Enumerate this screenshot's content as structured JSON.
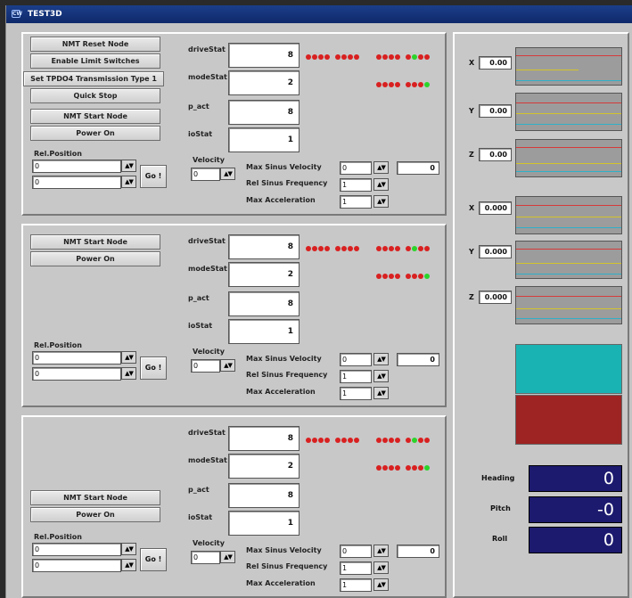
{
  "window": {
    "title": "TEST3D",
    "icon": "CW"
  },
  "colors": {
    "led_red": "#d92020",
    "led_green": "#2bd42b",
    "cyan": "#1ab3b3",
    "darkred": "#9e2323",
    "navy": "#1c1a6e"
  },
  "labels": {
    "driveStat": "driveStat",
    "modeStat": "modeStat",
    "p_act": "p_act",
    "ioStat": "ioStat",
    "velocity": "Velocity",
    "max_sinus_velocity": "Max Sinus Velocity",
    "rel_sinus_frequency": "Rel Sinus Frequency",
    "max_acceleration": "Max Acceleration",
    "rel_position": "Rel.Position",
    "go": "Go !",
    "spin": "▲▼"
  },
  "panels": [
    {
      "buttons": [
        "NMT Reset Node",
        "Enable Limit Switches",
        "Set  TPDO4 Transmission Type 1",
        "Quick Stop",
        "NMT Start Node",
        "Power On"
      ],
      "stats": {
        "driveStat": "8",
        "modeStat": "2",
        "p_act": "8",
        "ioStat": "1"
      },
      "rel_position": [
        "0",
        "0"
      ],
      "velocity": "0",
      "max_sinus_velocity": "0",
      "max_sinus_velocity_readout": "0",
      "rel_sinus_frequency": "1",
      "max_acceleration": "1"
    },
    {
      "buttons": [
        "NMT Start Node",
        "Power On"
      ],
      "stats": {
        "driveStat": "8",
        "modeStat": "2",
        "p_act": "8",
        "ioStat": "1"
      },
      "rel_position": [
        "0",
        "0"
      ],
      "velocity": "0",
      "max_sinus_velocity": "0",
      "max_sinus_velocity_readout": "0",
      "rel_sinus_frequency": "1",
      "max_acceleration": "1"
    },
    {
      "buttons": [
        "NMT Start Node",
        "Power On"
      ],
      "stats": {
        "driveStat": "8",
        "modeStat": "2",
        "p_act": "8",
        "ioStat": "1"
      },
      "rel_position": [
        "0",
        "0"
      ],
      "velocity": "0",
      "max_sinus_velocity": "0",
      "max_sinus_velocity_readout": "0",
      "rel_sinus_frequency": "1",
      "max_acceleration": "1"
    }
  ],
  "right": {
    "axes_a": [
      {
        "axis": "X",
        "value": "0.00"
      },
      {
        "axis": "Y",
        "value": "0.00"
      },
      {
        "axis": "Z",
        "value": "0.00"
      }
    ],
    "axes_b": [
      {
        "axis": "X",
        "value": "0.000"
      },
      {
        "axis": "Y",
        "value": "0.000"
      },
      {
        "axis": "Z",
        "value": "0.000"
      }
    ],
    "attitude": [
      {
        "label": "Heading",
        "value": "0"
      },
      {
        "label": "Pitch",
        "value": "-0"
      },
      {
        "label": "Roll",
        "value": "0"
      }
    ]
  }
}
